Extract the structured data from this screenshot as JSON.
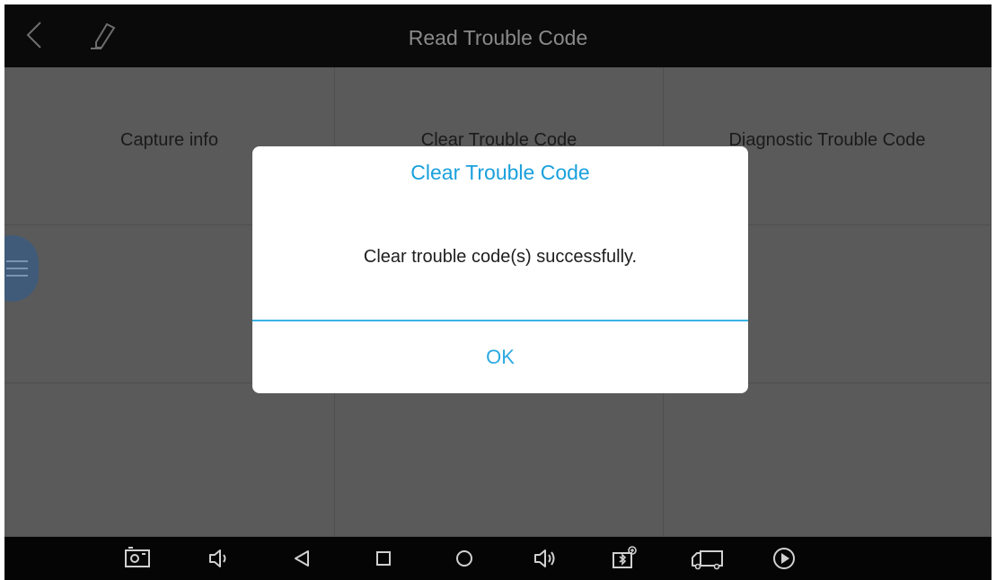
{
  "header": {
    "title": "Read Trouble Code",
    "back_icon": "chevron-left-icon",
    "edit_icon": "pencil-icon"
  },
  "menu": {
    "items": [
      {
        "label": "Capture info"
      },
      {
        "label": "Clear Trouble Code"
      },
      {
        "label": "Diagnostic Trouble Code"
      }
    ]
  },
  "floating_menu": {
    "icon": "hamburger-icon"
  },
  "dialog": {
    "title": "Clear Trouble Code",
    "message": "Clear trouble code(s) successfully.",
    "ok_label": "OK"
  },
  "navbar": {
    "icons": [
      "screenshot-icon",
      "volume-down-icon",
      "back-triangle-icon",
      "recent-apps-square-icon",
      "home-circle-icon",
      "volume-up-icon",
      "bluetooth-vci-icon",
      "truck-icon",
      "play-circle-icon"
    ]
  },
  "colors": {
    "accent": "#1aa0dc",
    "topbar": "#0a0a0a",
    "overlay_cell": "#5a5a5a",
    "navbar": "#050505"
  }
}
